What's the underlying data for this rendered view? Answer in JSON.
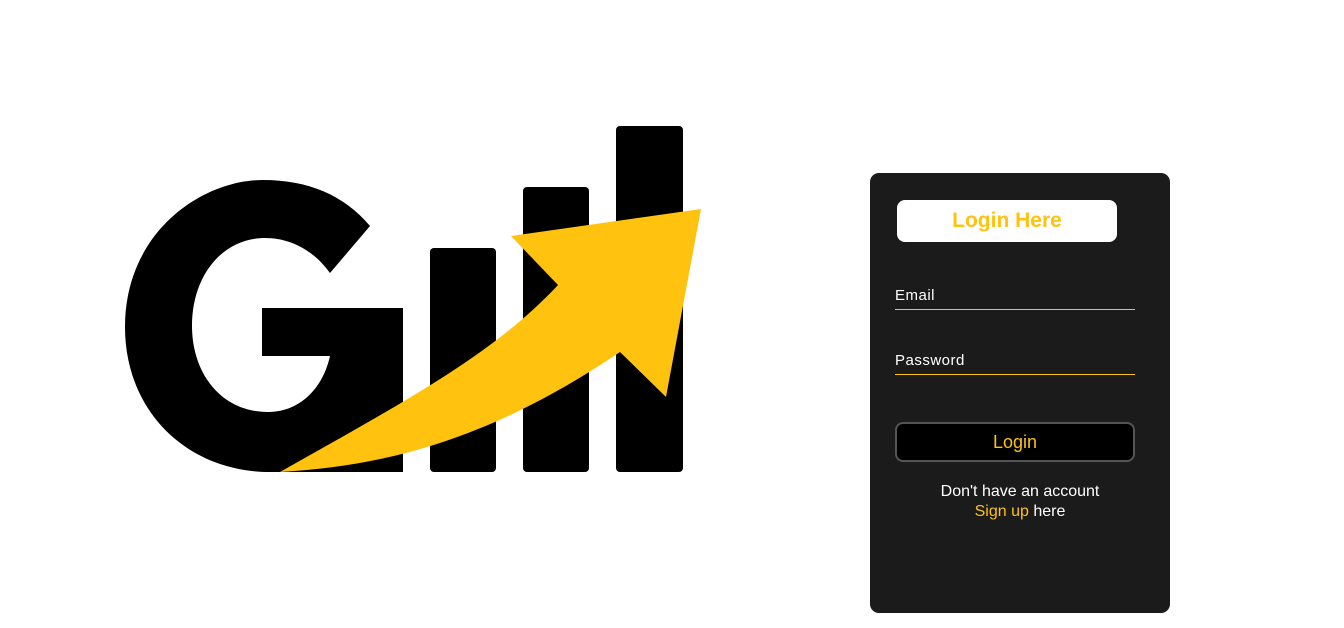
{
  "brand": {
    "logo_name": "gill-logo",
    "colors": {
      "primary": "#000000",
      "accent": "#ffc20e"
    }
  },
  "login": {
    "title": "Login Here",
    "email_placeholder": "Email",
    "password_placeholder": "Password",
    "button_label": "Login",
    "signup_prompt": "Don't have an account",
    "signup_link": "Sign up",
    "signup_suffix": " here"
  },
  "colors": {
    "panel_background": "#1b1b1b",
    "accent": "#ffc20e",
    "text": "#ffffff"
  }
}
